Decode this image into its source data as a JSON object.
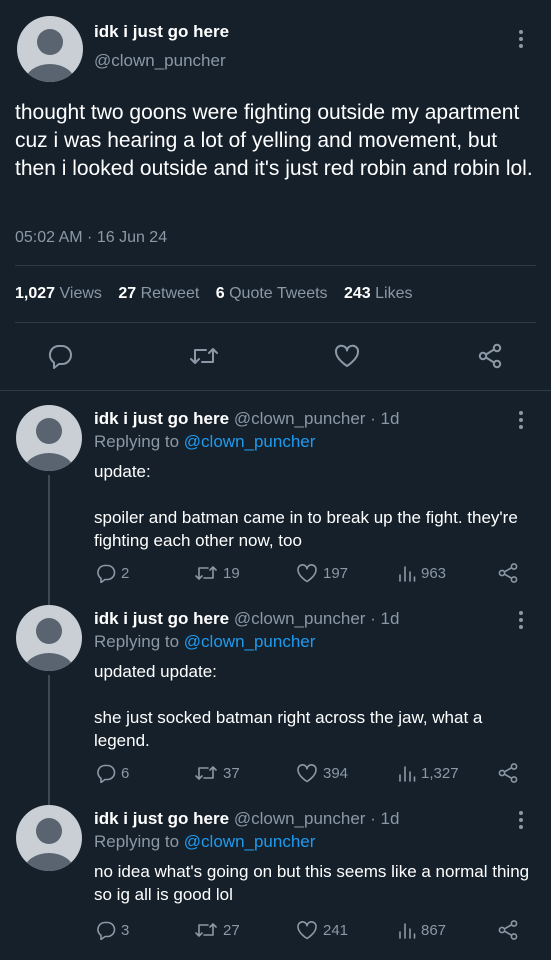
{
  "main_tweet": {
    "display_name": "idk i just go here",
    "handle": "@clown_puncher",
    "text": "thought two goons were fighting outside my apartment cuz i was hearing a lot of yelling and movement, but then i looked outside and it's just red robin and robin lol.",
    "timestamp": "05:02 AM · 16 Jun 24",
    "stats": {
      "views_count": "1,027",
      "views_label": "Views",
      "retweets_count": "27",
      "retweets_label": "Retweet",
      "quotes_count": "6",
      "quotes_label": "Quote Tweets",
      "likes_count": "243",
      "likes_label": "Likes"
    }
  },
  "replies": [
    {
      "display_name": "idk i just go here",
      "meta": "@clown_puncher · 1d",
      "replying_prefix": "Replying to",
      "replying_to": "@clown_puncher",
      "text_line1": "update:",
      "text_line2": "spoiler and batman came in to break up the fight. they're fighting each other now, too",
      "replies": "2",
      "retweets": "19",
      "likes": "197",
      "views": "963"
    },
    {
      "display_name": "idk i just go here",
      "meta": "@clown_puncher · 1d",
      "replying_prefix": "Replying to",
      "replying_to": "@clown_puncher",
      "text_line1": "updated update:",
      "text_line2": "she just socked batman right across the jaw, what a legend.",
      "replies": "6",
      "retweets": "37",
      "likes": "394",
      "views": "1,327"
    },
    {
      "display_name": "idk i just go here",
      "meta": "@clown_puncher · 1d",
      "replying_prefix": "Replying to",
      "replying_to": "@clown_puncher",
      "text_line1": "no idea what's going on but this seems like a normal thing so ig all is good lol",
      "text_line2": "",
      "replies": "3",
      "retweets": "27",
      "likes": "241",
      "views": "867"
    }
  ],
  "colors": {
    "background": "#15202b",
    "accent": "#1d9bf0",
    "muted": "#8b98a5",
    "divider": "#2f3b47"
  },
  "icons": [
    "more-icon",
    "reply-icon",
    "retweet-icon",
    "like-icon",
    "share-icon",
    "views-icon"
  ]
}
